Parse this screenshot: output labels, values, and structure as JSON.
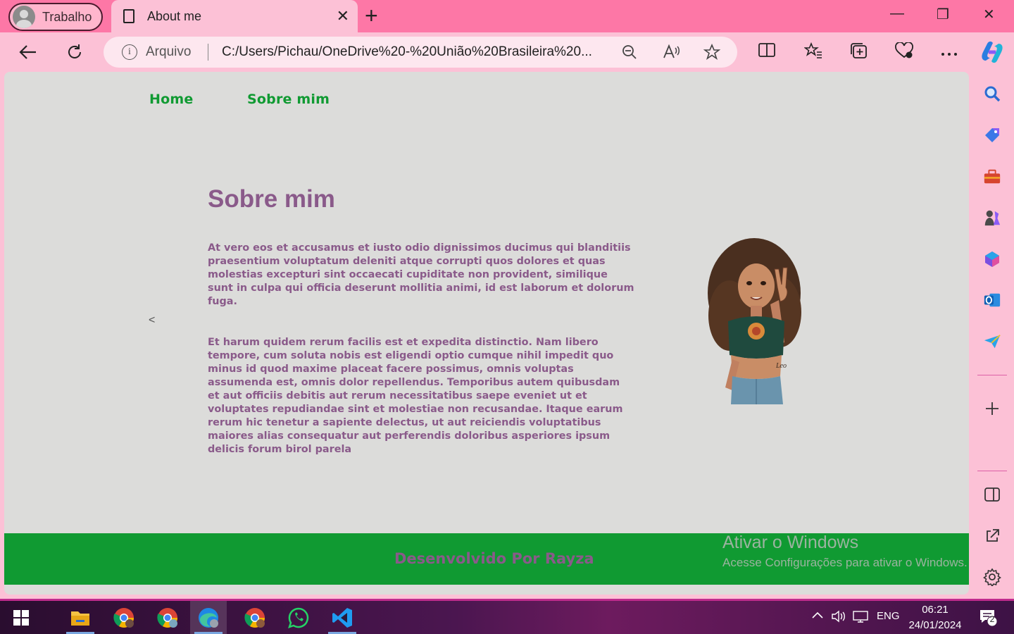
{
  "browser": {
    "profile_label": "Trabalho",
    "tab_title": "About me",
    "tab_close": "✕",
    "new_tab": "+",
    "address_scheme": "Arquivo",
    "address_url": "C:/Users/Pichau/OneDrive%20-%20União%20Brasileira%20...",
    "window_controls": [
      "—",
      "❐",
      "✕"
    ]
  },
  "page": {
    "nav": [
      "Home",
      "Sobre mim"
    ],
    "back_marker": "<",
    "heading": "Sobre mim",
    "paragraphs": [
      "At vero eos et accusamus et iusto odio dignissimos ducimus qui blanditiis praesentium voluptatum deleniti atque corrupti quos dolores et quas molestias excepturi sint occaecati cupiditate non provident, similique sunt in culpa qui officia deserunt mollitia animi, id est laborum et dolorum fuga.",
      "Et harum quidem rerum facilis est et expedita distinctio. Nam libero tempore, cum soluta nobis est eligendi optio cumque nihil impedit quo minus id quod maxime placeat facere possimus, omnis voluptas assumenda est, omnis dolor repellendus. Temporibus autem quibusdam et aut officiis debitis aut rerum necessitatibus saepe eveniet ut et voluptates repudiandae sint et molestiae non recusandae. Itaque earum rerum hic tenetur a sapiente delectus, ut aut reiciendis voluptatibus maiores alias consequatur aut perferendis doloribus asperiores ipsum delicis forum birol parela"
    ],
    "footer_credit": "Desenvolvido Por Rayza",
    "colors": {
      "nav_green": "#109a32",
      "text_purple": "#8a5a8a",
      "page_bg": "#dcdcda"
    }
  },
  "watermark": {
    "line1": "Ativar o Windows",
    "line2": "Acesse Configurações para ativar o Windows."
  },
  "taskbar": {
    "language": "ENG",
    "time": "06:21",
    "date": "24/01/2024",
    "notification_count": "2"
  }
}
